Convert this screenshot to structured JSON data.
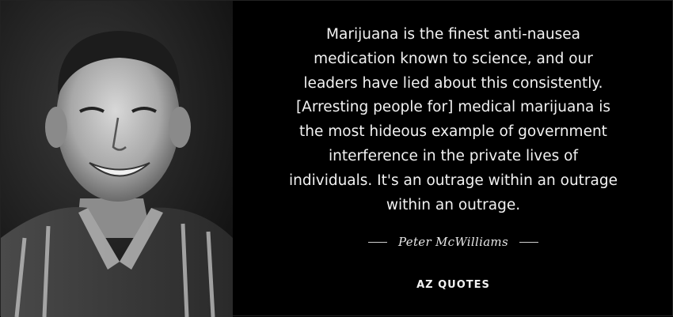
{
  "quote": {
    "lines": [
      "Marijuana is the finest anti-nausea",
      "medication known to science, and our",
      "leaders have lied about this consistently.",
      "[Arresting people for] medical marijuana is",
      "the most hideous example of government",
      "interference in the private lives of",
      "individuals. It's an outrage within an outrage",
      "within an outrage."
    ]
  },
  "author": {
    "name": "Peter McWilliams"
  },
  "logo": {
    "text": "AZ QUOTES"
  },
  "colors": {
    "background": "#000000",
    "text": "#f2f2f2"
  }
}
